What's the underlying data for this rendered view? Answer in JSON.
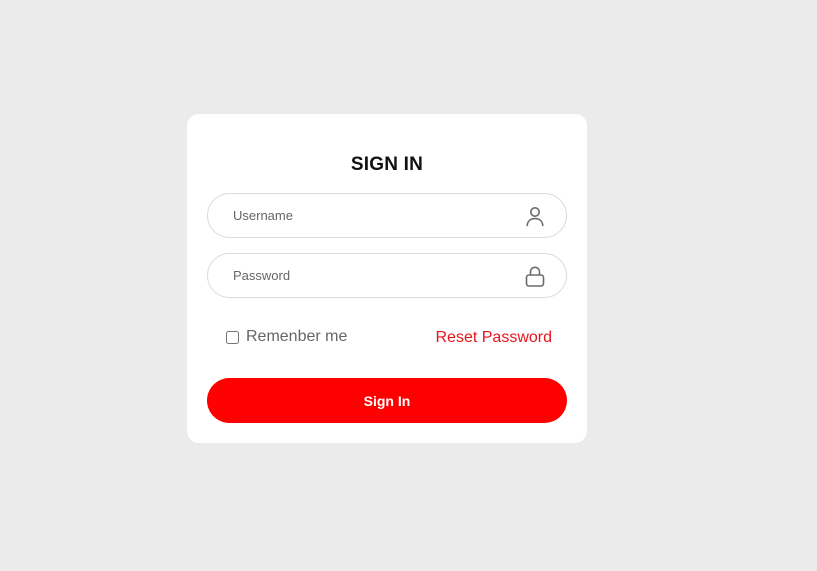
{
  "login": {
    "title": "SIGN IN",
    "username": {
      "placeholder": "Username",
      "value": "",
      "icon": "user-icon"
    },
    "password": {
      "placeholder": "Password",
      "value": "",
      "icon": "lock-icon"
    },
    "remember_label": "Remenber me",
    "remember_checked": false,
    "reset_label": "Reset Password",
    "submit_label": "Sign In"
  },
  "colors": {
    "background": "#ebebeb",
    "card": "#ffffff",
    "accent": "#ff0000",
    "link": "#e8141b"
  }
}
